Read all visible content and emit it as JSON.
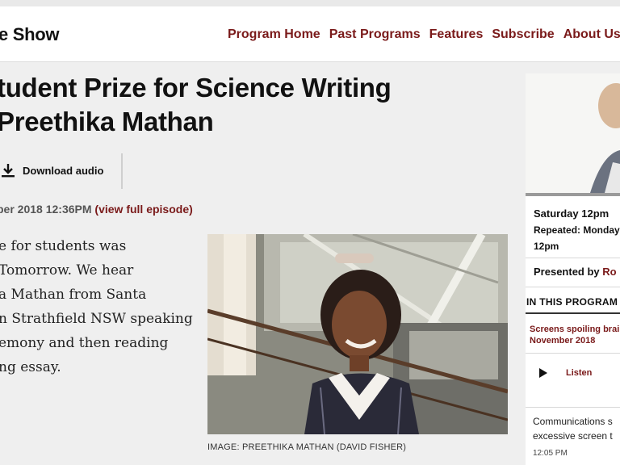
{
  "header": {
    "brand": "e Show",
    "nav": [
      "Program Home",
      "Past Programs",
      "Features",
      "Subscribe",
      "About Us"
    ]
  },
  "article": {
    "title_line1": "tudent Prize for Science Writing",
    "title_line2": "Preethika Mathan",
    "download_label": "Download audio",
    "date": "ber 2018 12:36PM",
    "view_episode": "(view full episode)",
    "body_lines": [
      "e for students was",
      "Tomorrow. We hear",
      "a Mathan from Santa",
      "n Strathfield NSW speaking",
      "emony and then reading",
      "ng essay."
    ],
    "image_caption": "IMAGE: PREETHIKA MATHAN (DAVID FISHER)"
  },
  "sidebar": {
    "schedule": "Saturday 12pm",
    "repeated_line1": "Repeated: Monday",
    "repeated_line2": "12pm",
    "presented_by_label": "Presented by",
    "presented_by_name": "Ro",
    "in_this_program": "IN THIS PROGRAM",
    "link_line1": "Screens spoiling brai",
    "link_line2": "November 2018",
    "listen_label": "Listen",
    "item_line1": "Communications s",
    "item_line2": "excessive screen t",
    "item_time": "12:05 PM"
  },
  "colors": {
    "accent": "#7a1a1a",
    "header_bg": "#ffffff",
    "page_bg": "#efefef"
  }
}
